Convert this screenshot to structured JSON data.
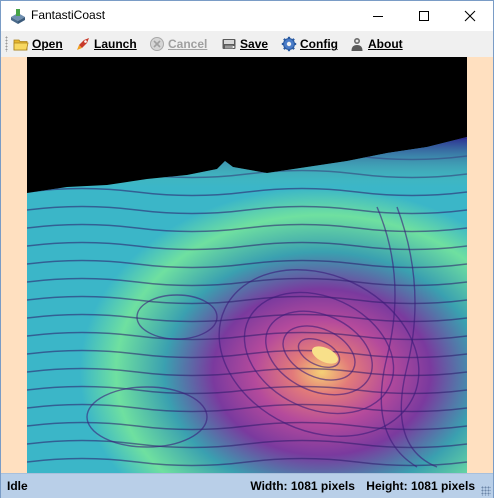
{
  "window": {
    "title": "FantastiCoast"
  },
  "toolbar": {
    "items": [
      {
        "label": "Open",
        "icon": "folder-icon",
        "enabled": true
      },
      {
        "label": "Launch",
        "icon": "rocket-icon",
        "enabled": true
      },
      {
        "label": "Cancel",
        "icon": "cancel-icon",
        "enabled": false
      },
      {
        "label": "Save",
        "icon": "save-icon",
        "enabled": true
      },
      {
        "label": "Config",
        "icon": "gear-icon",
        "enabled": true
      },
      {
        "label": "About",
        "icon": "person-icon",
        "enabled": true
      }
    ]
  },
  "canvas": {
    "background": "#ffe0c0",
    "colormap": [
      "#000000",
      "#2a1a8a",
      "#6a2f9a",
      "#b04a9c",
      "#e07a7a",
      "#f0c070",
      "#6fe0a0",
      "#3bb6c8"
    ]
  },
  "status": {
    "state": "Idle",
    "width_label": "Width: 1081 pixels",
    "height_label": "Height: 1081 pixels"
  }
}
